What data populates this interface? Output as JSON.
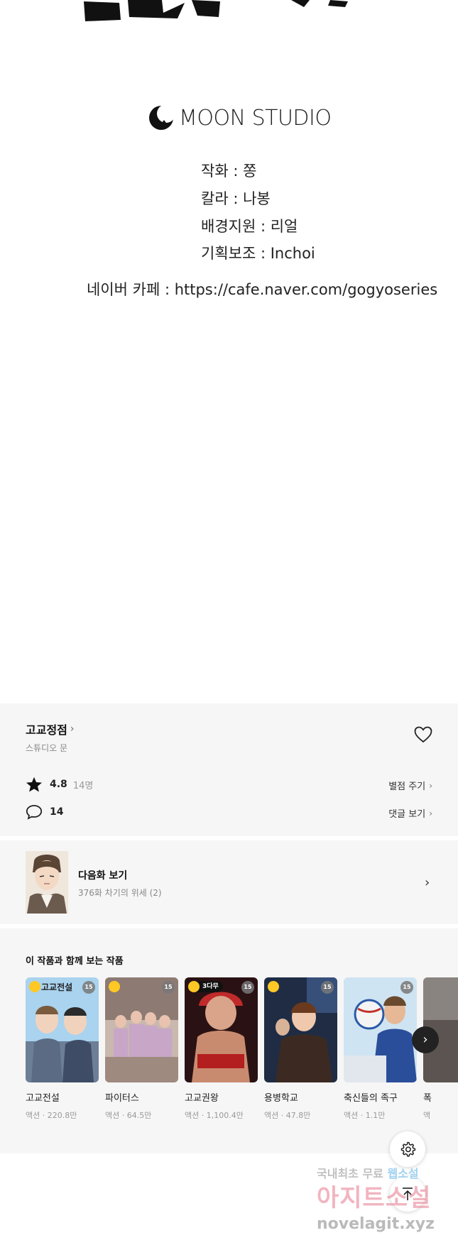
{
  "studio": {
    "name": "MOON STUDIO"
  },
  "credits": [
    "작화 : 쫑",
    "칼라 : 나봉",
    "배경지원 : 리얼",
    "기획보조 : Inchoi"
  ],
  "cafe": "네이버 카페 : https://cafe.naver.com/gogyoseries",
  "series": {
    "title": "고교정점",
    "author": "스튜디오 문",
    "rating": "4.8",
    "rating_count": "14명",
    "rate_link": "별점 주기",
    "comments": "14",
    "comments_link": "댓글 보기"
  },
  "next_episode": {
    "label": "다음화 보기",
    "subtitle": "376화 차기의 위세 (2)"
  },
  "recommend": {
    "heading": "이 작품과 함께 보는 작품",
    "items": [
      {
        "name": "고교전설",
        "meta": "액션 · 220.8만",
        "badge": "15",
        "tag": ""
      },
      {
        "name": "파이터스",
        "meta": "액션 · 64.5만",
        "badge": "15",
        "tag": ""
      },
      {
        "name": "고교권왕",
        "meta": "액션 · 1,100.4만",
        "badge": "15",
        "tag": "3다무"
      },
      {
        "name": "용병학교",
        "meta": "액션 · 47.8만",
        "badge": "15",
        "tag": ""
      },
      {
        "name": "축신들의 족구",
        "meta": "액션 · 1.1만",
        "badge": "15",
        "tag": ""
      },
      {
        "name": "폭",
        "meta": "액",
        "badge": "",
        "tag": ""
      }
    ]
  },
  "watermark": {
    "line1_a": "국내최초 무료",
    "line1_b": "웹소설",
    "line2": "아지트소설",
    "line3": "novelagit.xyz"
  }
}
